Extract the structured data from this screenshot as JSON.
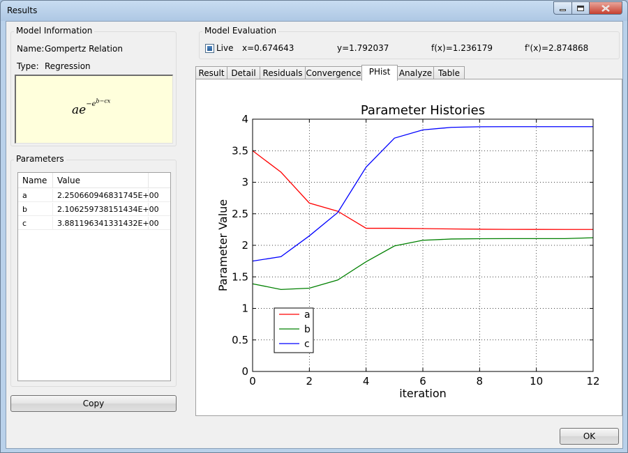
{
  "window": {
    "title": "Results"
  },
  "model_info": {
    "group_title": "Model Information",
    "name_label": "Name:",
    "name_value": "Gompertz Relation",
    "type_label": "Type:",
    "type_value": "Regression",
    "formula_base": "ae",
    "formula_exp_prefix": "−e",
    "formula_exp_sup": "b−cx"
  },
  "parameters": {
    "group_title": "Parameters",
    "columns": [
      "Name",
      "Value"
    ],
    "rows": [
      {
        "name": "a",
        "value": "2.250660946831745E+00"
      },
      {
        "name": "b",
        "value": "2.106259738151434E+00"
      },
      {
        "name": "c",
        "value": "3.881196341331432E+00"
      }
    ]
  },
  "copy_button": "Copy",
  "ok_button": "OK",
  "evaluation": {
    "group_title": "Model Evaluation",
    "live_label": "Live",
    "live_checked": true,
    "x": "x=0.674643",
    "y": "y=1.792037",
    "fx": "f(x)=1.236179",
    "fpx": "f'(x)=2.874868"
  },
  "tabs": [
    "Result",
    "Detail",
    "Residuals",
    "Convergence",
    "PHist",
    "Analyze",
    "Table"
  ],
  "active_tab": "PHist",
  "chart_data": {
    "type": "line",
    "title": "Parameter Histories",
    "xlabel": "iteration",
    "ylabel": "Parameter Value",
    "xlim": [
      0,
      12
    ],
    "ylim": [
      0,
      4
    ],
    "xticks": [
      0,
      2,
      4,
      6,
      8,
      10,
      12
    ],
    "yticks": [
      0,
      0.5,
      1,
      1.5,
      2,
      2.5,
      3,
      3.5,
      4
    ],
    "grid": true,
    "legend_position": "lower-left",
    "x": [
      0,
      1,
      2,
      3,
      4,
      5,
      6,
      7,
      8,
      9,
      10,
      11,
      12
    ],
    "series": [
      {
        "name": "a",
        "color": "#ff0000",
        "values": [
          3.5,
          3.16,
          2.67,
          2.54,
          2.27,
          2.27,
          2.265,
          2.26,
          2.255,
          2.253,
          2.252,
          2.251,
          2.251
        ]
      },
      {
        "name": "b",
        "color": "#008000",
        "values": [
          1.39,
          1.3,
          1.32,
          1.45,
          1.74,
          1.99,
          2.08,
          2.1,
          2.105,
          2.106,
          2.106,
          2.106,
          2.12
        ]
      },
      {
        "name": "c",
        "color": "#0000ff",
        "values": [
          1.75,
          1.82,
          2.15,
          2.52,
          3.24,
          3.7,
          3.83,
          3.87,
          3.88,
          3.881,
          3.881,
          3.881,
          3.881
        ]
      }
    ]
  }
}
